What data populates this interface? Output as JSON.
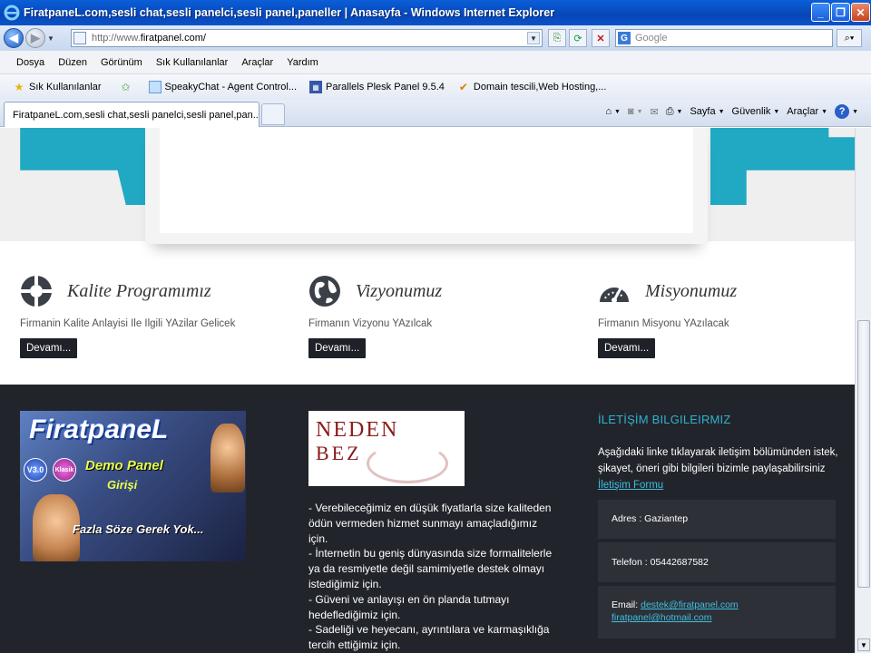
{
  "window": {
    "title": "FiratpaneL.com,sesli chat,sesli panelci,sesli panel,paneller | Anasayfa - Windows Internet Explorer"
  },
  "address": {
    "prefix": "http://www.",
    "domain": "firatpanel.com/"
  },
  "search": {
    "placeholder": "Google"
  },
  "menu": [
    "Dosya",
    "Düzen",
    "Görünüm",
    "Sık Kullanılanlar",
    "Araçlar",
    "Yardım"
  ],
  "favorites": {
    "label": "Sık Kullanılanlar",
    "items": [
      "SpeakyChat - Agent Control...",
      "Parallels Plesk Panel 9.5.4",
      "Domain tescili,Web Hosting,..."
    ]
  },
  "tab": {
    "label": "FiratpaneL.com,sesli chat,sesli panelci,sesli panel,pan..."
  },
  "commands": {
    "page": "Sayfa",
    "safety": "Güvenlik",
    "tools": "Araçlar"
  },
  "features": [
    {
      "title": "Kalite Programımız",
      "text": "Firmanin Kalite Anlayisi Ile Ilgili YAzilar Gelicek",
      "button": "Devamı..."
    },
    {
      "title": "Vizyonumuz",
      "text": "Firmanın Vizyonu YAzılcak",
      "button": "Devamı..."
    },
    {
      "title": "Misyonumuz",
      "text": "Firmanın Misyonu YAzılacak",
      "button": "Devamı..."
    }
  ],
  "banner": {
    "brand": "FiratpaneL",
    "badge1": "V3.0",
    "badge2": "Klasik",
    "demo": "Demo Panel",
    "login": "Girişi",
    "slogan": "Fazla Söze Gerek Yok..."
  },
  "neden": {
    "line1": "NEDEN",
    "line2": "BEZ"
  },
  "reasons": [
    "- Verebileceğimiz en düşük fiyatlarla size kaliteden ödün vermeden hizmet sunmayı amaçladığımız için.",
    "- İnternetin bu geniş dünyasında size formalitelerle ya da resmiyetle değil samimiyetle destek olmayı istediğimiz için.",
    "- Güveni ve anlayışı en ön planda tutmayı hedeflediğimiz için.",
    "- Sadeliği ve heyecanı, ayrıntılara ve karmaşıklığa tercih ettiğimiz için."
  ],
  "contact": {
    "heading": "İLETİŞİM BILGILEIRMIZ",
    "intro": "Aşağıdaki linke tıklayarak iletişim bölümünden istek, şikayet, öneri gibi bilgileri bizimle paylaşabilirsiniz",
    "link": "İletişim Formu",
    "address": "Adres : Gaziantep",
    "phone": "Telefon : 05442687582",
    "email_label": "Email:",
    "email1": "destek@firatpanel.com",
    "email2": "firatpanel@hotmail.com"
  },
  "colors": {
    "teal": "#21a9c3",
    "footer": "#22242b",
    "button": "#1e2128",
    "heading": "#2eb3ce"
  }
}
